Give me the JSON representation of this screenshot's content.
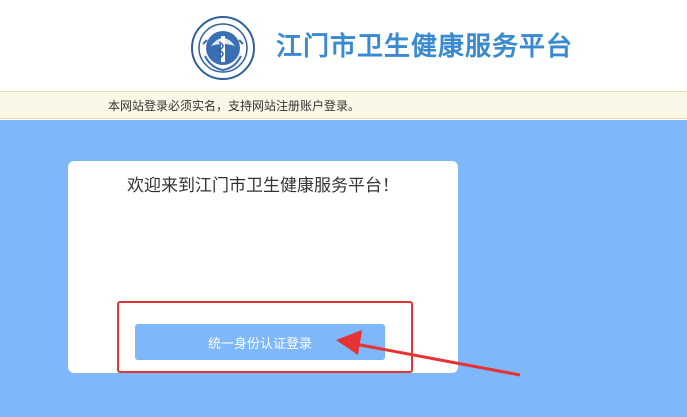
{
  "header": {
    "site_title": "江门市卫生健康服务平台",
    "logo_icon": "health-emblem-icon"
  },
  "notice": {
    "text": "本网站登录必须实名，支持网站注册账户登录。"
  },
  "login_card": {
    "welcome_text": "欢迎来到江门市卫生健康服务平台！",
    "button_label": "统一身份认证登录"
  },
  "annotation": {
    "highlight_color": "#e53333",
    "arrow_icon": "red-arrow-icon"
  },
  "colors": {
    "brand_blue": "#3a8ad1",
    "background_blue": "#7fb7fb",
    "notice_bg": "#fbf7e7"
  }
}
